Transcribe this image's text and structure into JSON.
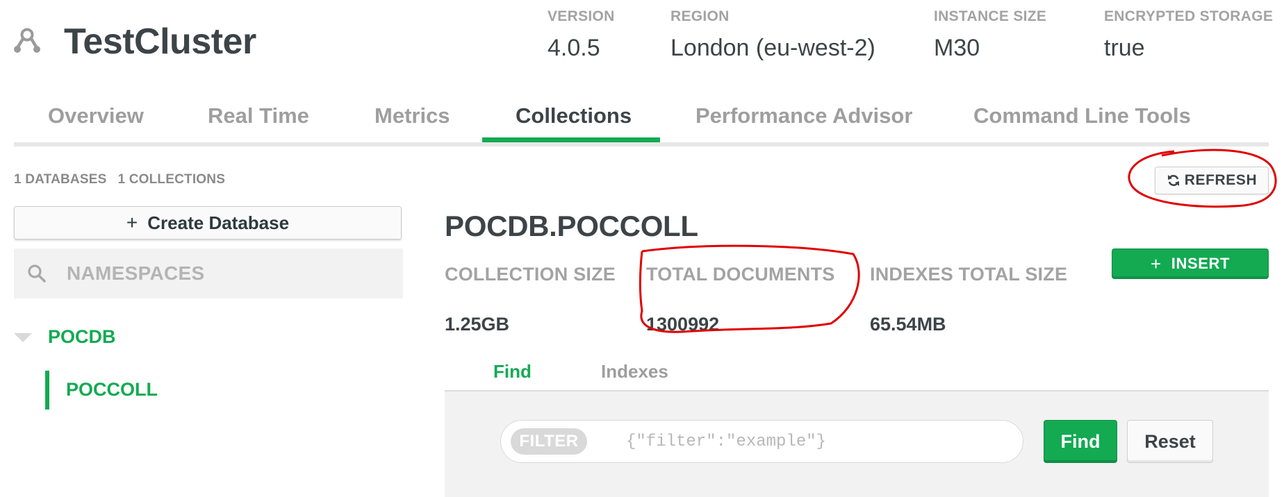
{
  "cluster": {
    "title": "TestCluster",
    "icon": "cluster-icon"
  },
  "meta": [
    {
      "label": "VERSION",
      "value": "4.0.5"
    },
    {
      "label": "REGION",
      "value": "London (eu-west-2)"
    },
    {
      "label": "INSTANCE SIZE",
      "value": "M30"
    },
    {
      "label": "ENCRYPTED STORAGE",
      "value": "true"
    }
  ],
  "tabs": [
    {
      "label": "Overview",
      "active": false
    },
    {
      "label": "Real Time",
      "active": false
    },
    {
      "label": "Metrics",
      "active": false
    },
    {
      "label": "Collections",
      "active": true
    },
    {
      "label": "Performance Advisor",
      "active": false
    },
    {
      "label": "Command Line Tools",
      "active": false
    }
  ],
  "sidebar": {
    "databases_count": "1 DATABASES",
    "collections_count": "1 COLLECTIONS",
    "create_database_label": "Create Database",
    "search_placeholder": "NAMESPACES",
    "database": "POCDB",
    "collection": "POCCOLL"
  },
  "main": {
    "refresh_label": "REFRESH",
    "namespace": "POCDB.POCCOLL",
    "insert_label": "INSERT",
    "stats": [
      {
        "label": "COLLECTION SIZE",
        "value": "1.25GB"
      },
      {
        "label": "TOTAL DOCUMENTS",
        "value": "1300992"
      },
      {
        "label": "INDEXES TOTAL SIZE",
        "value": "65.54MB"
      }
    ],
    "subtabs": [
      {
        "label": "Find",
        "active": true
      },
      {
        "label": "Indexes",
        "active": false
      }
    ],
    "query": {
      "filter_badge": "FILTER",
      "filter_placeholder": "{\"filter\":\"example\"}",
      "find_label": "Find",
      "reset_label": "Reset"
    }
  },
  "colors": {
    "accent_green": "#13aa52",
    "annotation_red": "#e00000",
    "text_dark": "#3d4448",
    "text_muted": "#a3a3a3"
  }
}
